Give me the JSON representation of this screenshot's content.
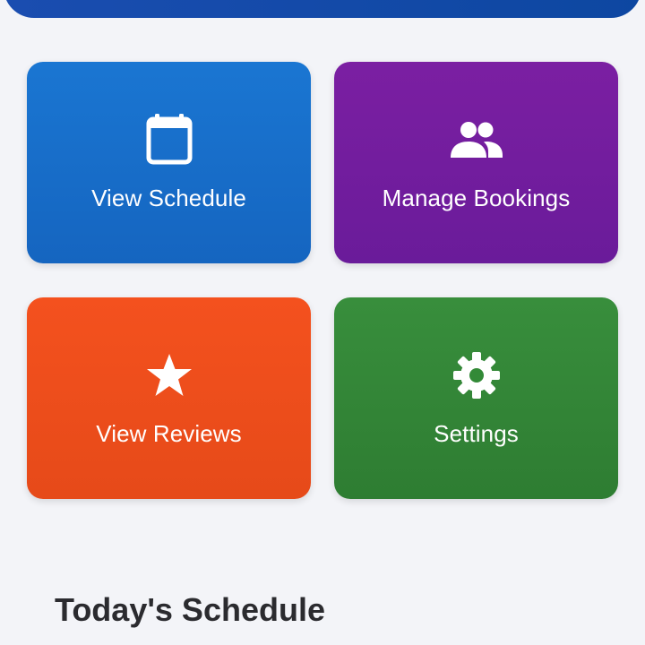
{
  "tiles": {
    "schedule": {
      "label": "View Schedule",
      "icon": "calendar-icon",
      "color": "#1a76d2"
    },
    "bookings": {
      "label": "Manage Bookings",
      "icon": "people-icon",
      "color": "#7b1fa2"
    },
    "reviews": {
      "label": "View Reviews",
      "icon": "star-icon",
      "color": "#f4511e"
    },
    "settings": {
      "label": "Settings",
      "icon": "gear-icon",
      "color": "#388e3c"
    }
  },
  "schedule_section": {
    "title": "Today's Schedule"
  },
  "colors": {
    "header": "#0d47a1",
    "background": "#f3f4f8"
  }
}
